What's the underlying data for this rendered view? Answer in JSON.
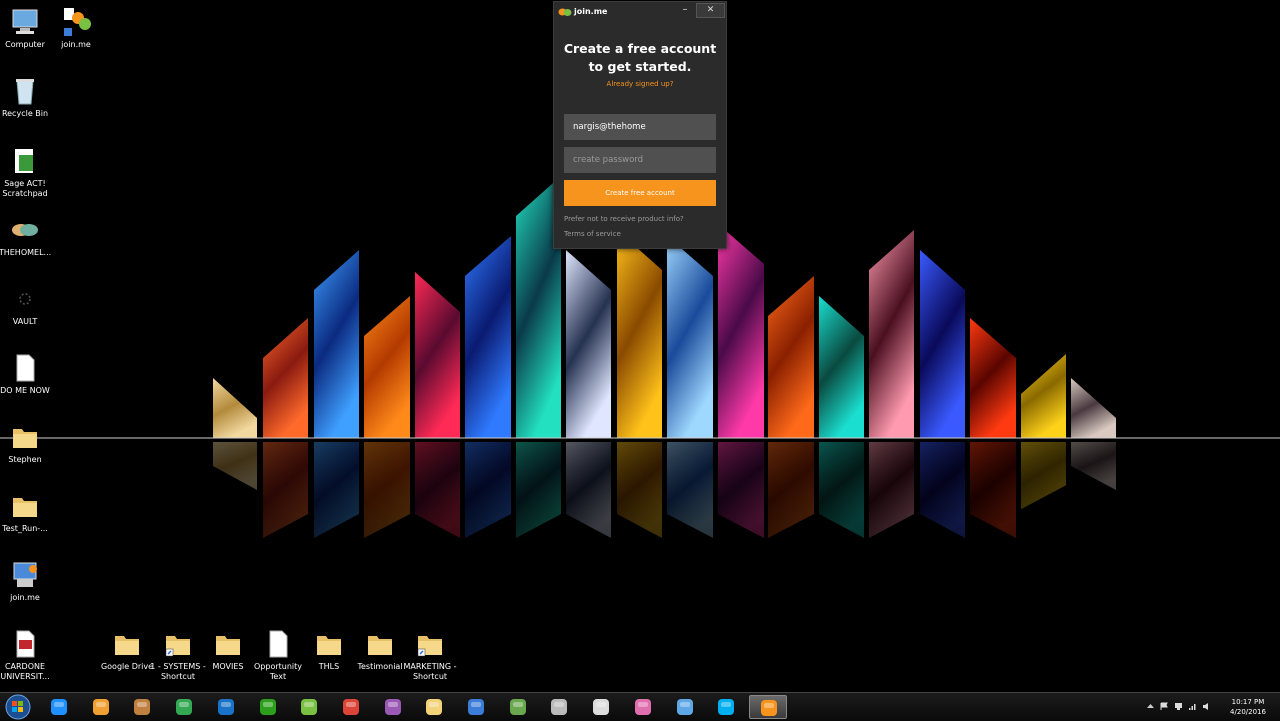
{
  "desktop": {
    "left_icons": [
      {
        "label": "Computer",
        "icon": "computer-icon"
      },
      {
        "label": "Recycle Bin",
        "icon": "recycle-bin-icon"
      },
      {
        "label": "Sage ACT! Scratchpad",
        "icon": "sage-act-icon"
      },
      {
        "label": "THEHOMEL...",
        "icon": "handshake-icon"
      },
      {
        "label": "VAULT",
        "icon": "vault-icon"
      },
      {
        "label": "DO ME NOW",
        "icon": "document-icon"
      },
      {
        "label": "Stephen",
        "icon": "folder-icon"
      },
      {
        "label": "Test_Run-...",
        "icon": "folder-icon"
      },
      {
        "label": "join.me",
        "icon": "joinme-installer-icon"
      },
      {
        "label": "CARDONE UNIVERSIT...",
        "icon": "pdf-icon"
      }
    ],
    "second_column": [
      {
        "label": "join.me",
        "icon": "joinme-icon"
      }
    ],
    "bottom_icons": [
      {
        "label": "Google Drive",
        "icon": "folder-icon"
      },
      {
        "label": "1 - SYSTEMS - Shortcut",
        "icon": "folder-shortcut-icon"
      },
      {
        "label": "MOVIES",
        "icon": "folder-icon"
      },
      {
        "label": "Opportunity Text",
        "icon": "document-icon"
      },
      {
        "label": "THLS",
        "icon": "folder-icon"
      },
      {
        "label": "Testimonial",
        "icon": "folder-icon"
      },
      {
        "label": "MARKETING - Shortcut",
        "icon": "folder-shortcut-icon"
      }
    ]
  },
  "joinme_window": {
    "title": "join.me",
    "minimize": "–",
    "close": "✕",
    "heading_line1": "Create a free account",
    "heading_line2": "to get started.",
    "already_signed_up": "Already signed up?",
    "email_value": "nargis@thehome",
    "password_placeholder": "create password",
    "create_button": "Create free account",
    "prefer_not_link": "Prefer not to receive product info?",
    "terms_link": "Terms of service",
    "accent_color": "#f7941d"
  },
  "taskbar": {
    "apps": [
      {
        "name": "internet-explorer-icon",
        "color": "#1e90ff"
      },
      {
        "name": "media-player-icon",
        "color": "#f0a030"
      },
      {
        "name": "home-app-icon",
        "color": "#c08040"
      },
      {
        "name": "google-drive-icon",
        "color": "#34a853"
      },
      {
        "name": "outlook-icon",
        "color": "#1a73c8"
      },
      {
        "name": "quickbooks-icon",
        "color": "#2ca01c"
      },
      {
        "name": "evernote-icon",
        "color": "#7ac043"
      },
      {
        "name": "chrome-icon",
        "color": "#db4437"
      },
      {
        "name": "app-star-icon",
        "color": "#9b59b6"
      },
      {
        "name": "file-explorer-icon",
        "color": "#f3d27a"
      },
      {
        "name": "network-app-icon",
        "color": "#3b7dd8"
      },
      {
        "name": "handshake-app-icon",
        "color": "#6aa84f"
      },
      {
        "name": "camera-app-icon",
        "color": "#bbbbbb"
      },
      {
        "name": "screen-app-icon",
        "color": "#dddddd"
      },
      {
        "name": "paint-app-icon",
        "color": "#e06fb0"
      },
      {
        "name": "remote-desktop-icon",
        "color": "#5fa8e8"
      },
      {
        "name": "skype-icon",
        "color": "#00aff0"
      },
      {
        "name": "joinme-taskbar-icon",
        "color": "#f7941d"
      }
    ],
    "clock_time": "10:17 PM",
    "clock_date": "4/20/2016"
  }
}
